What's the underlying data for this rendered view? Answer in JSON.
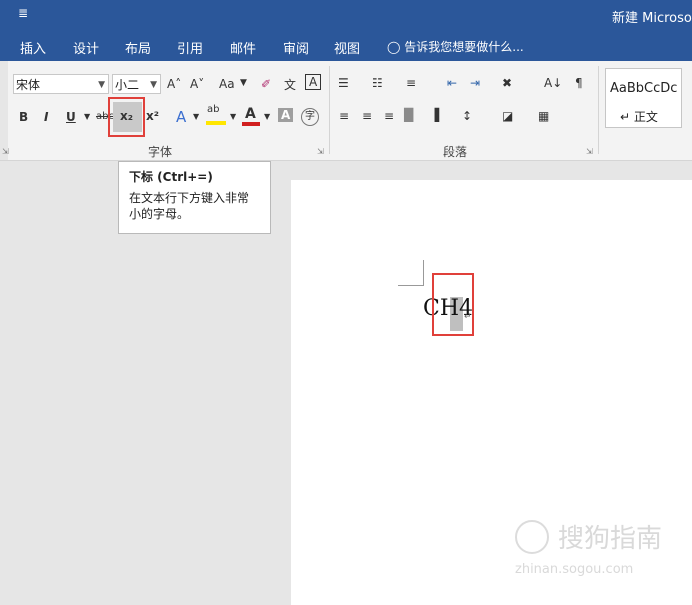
{
  "title_bar": {
    "quick_access": "≣",
    "document_title": "新建 Microsoft"
  },
  "tabs": [
    "插入",
    "设计",
    "布局",
    "引用",
    "邮件",
    "审阅",
    "视图"
  ],
  "tell_me": "告诉我您想要做什么...",
  "font_group": {
    "label": "字体",
    "font_name": "宋体",
    "font_size": "小二",
    "buttons": {
      "grow": "A˄",
      "shrink": "A˅",
      "case": "Aa",
      "clear": "✐",
      "phonetic": "文",
      "border_char": "A",
      "bold": "B",
      "italic": "I",
      "underline": "U",
      "strike": "abc",
      "subscript": "x₂",
      "superscript": "x²",
      "effects": "A",
      "highlight": "ab",
      "font_color": "A",
      "shading": "A",
      "enclose": "字"
    }
  },
  "paragraph_group": {
    "label": "段落",
    "row1": [
      "☰",
      "☷",
      "≡",
      "⇤",
      "⇥",
      "✖",
      "A↓",
      "¶"
    ],
    "row2": [
      "≡",
      "≡",
      "≡",
      "█",
      "▐",
      "↕",
      "◪",
      "▦"
    ]
  },
  "styles": {
    "sample": "AaBbCcDc",
    "name": "↵ 正文"
  },
  "tooltip": {
    "title": "下标 (Ctrl+=)",
    "description": "在文本行下方键入非常小的字母。"
  },
  "document": {
    "text": "CH4",
    "para_mark": "↵"
  },
  "watermark": {
    "text": "搜狗指南",
    "url": "zhinan.sogou.com"
  },
  "colors": {
    "ribbon_blue": "#2b579a",
    "highlight_red": "#e0403a",
    "font_color_red": "#d11f1f",
    "highlighter_yellow": "#ffe600"
  }
}
